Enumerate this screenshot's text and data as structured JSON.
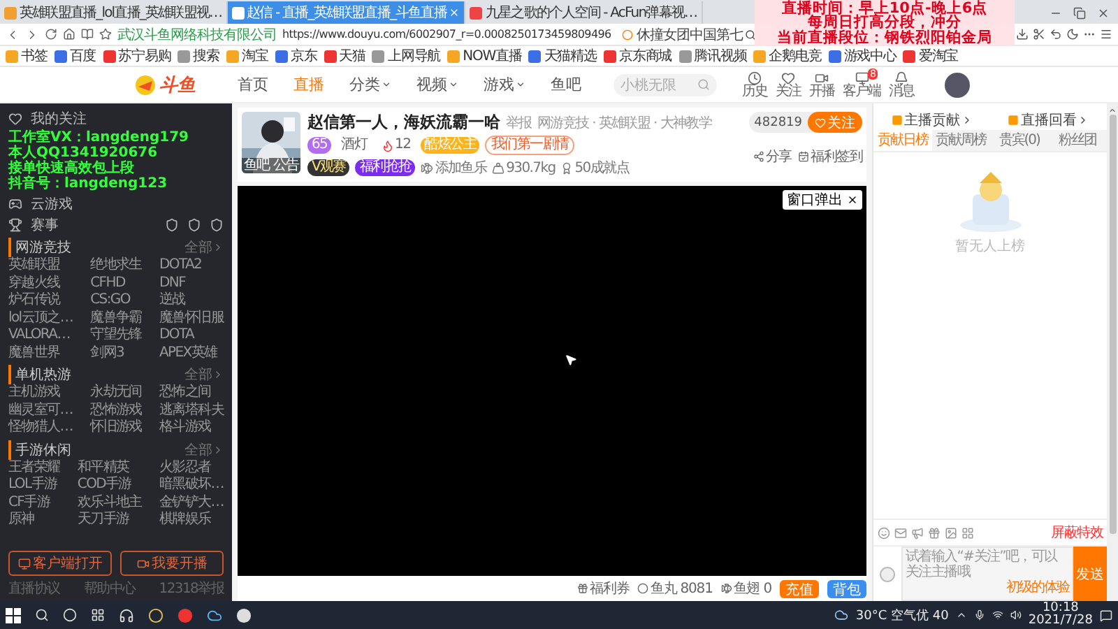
{
  "browser": {
    "tabs": [
      {
        "title": "英雄联盟直播_lol直播_英雄联盟视…",
        "selected": false
      },
      {
        "title": "赵信 - 直播_英雄联盟直播_斗鱼直播",
        "selected": true
      },
      {
        "title": "九星之歌的个人空间 - AcFun弹幕视…",
        "selected": false
      }
    ],
    "site_identity": "武汉斗鱼网络科技有限公司",
    "url": "https://www.douyu.com/6002907_r=0.0008250173459809496",
    "search": {
      "value": "休撞女团中国第七"
    },
    "bookmarks": [
      "书签",
      "百度",
      "苏宁易购",
      "搜索",
      "淘宝",
      "京东",
      "天猫",
      "上网导航",
      "NOW直播",
      "天猫精选",
      "京东商城",
      "腾讯视频",
      "企鹅电竞",
      "游戏中心",
      "爱淘宝"
    ]
  },
  "schedule_overlay": [
    "直播时间：早上10点-晚上6点",
    "每周日打高分段，冲分",
    "当前直播段位：钢铁烈阳铂金局"
  ],
  "site_nav": {
    "logo": "斗鱼",
    "items": [
      {
        "label": "首页",
        "selected": false,
        "has_menu": false
      },
      {
        "label": "直播",
        "selected": true,
        "has_menu": false
      },
      {
        "label": "分类",
        "selected": false,
        "has_menu": true
      },
      {
        "label": "视频",
        "selected": false,
        "has_menu": true
      },
      {
        "label": "游戏",
        "selected": false,
        "has_menu": true
      },
      {
        "label": "鱼吧",
        "selected": false,
        "has_menu": false
      }
    ],
    "search": {
      "placeholder": "小桃无限"
    },
    "user_icons": [
      {
        "kind": "history",
        "label": "历史"
      },
      {
        "kind": "follow",
        "label": "关注"
      },
      {
        "kind": "broadcast",
        "label": "开播"
      },
      {
        "kind": "client",
        "label": "客户端",
        "badge": "8"
      },
      {
        "kind": "message",
        "label": "消息"
      }
    ]
  },
  "sidebar": {
    "follow": "我的关注",
    "contact_overlay": [
      "工作室VX：langdeng179",
      "本人QQ1341920676",
      "接单快速高效包上段",
      "抖音号：langdeng123"
    ],
    "cloud": "云游戏",
    "events": "赛事",
    "sections": [
      {
        "title": "网游竞技",
        "more": "全部",
        "items": [
          "英雄联盟",
          "绝地求生",
          "DOTA2",
          "穿越火线",
          "CFHD",
          "DNF",
          "炉石传说",
          "CS:GO",
          "逆战",
          "lol云顶之…",
          "魔兽争霸",
          "魔兽怀旧服",
          "VALORA…",
          "守望先锋",
          "DOTA",
          "魔兽世界",
          "剑网3",
          "APEX英雄"
        ]
      },
      {
        "title": "单机热游",
        "more": "全部",
        "items": [
          "主机游戏",
          "永劫无间",
          "恐怖之间",
          "幽灵室可…",
          "恐怖游戏",
          "逃离塔科夫",
          "怪物猎人…",
          "怀旧游戏",
          "格斗游戏"
        ]
      },
      {
        "title": "手游休闲",
        "more": "全部",
        "items": [
          "王者荣耀",
          "和平精英",
          "火影忍者",
          "LOL手游",
          "COD手游",
          "暗黑破坏…",
          "CF手游",
          "欢乐斗地主",
          "金铲铲大…",
          "原神",
          "天刀手游",
          "棋牌娱乐"
        ]
      }
    ],
    "buttons": [
      "客户端打开",
      "我要开播"
    ],
    "footer": [
      "直播协议",
      "帮助中心",
      "12318举报"
    ]
  },
  "streamer": {
    "avatar_caption": [
      "鱼吧",
      "公告"
    ],
    "title": "赵信第一人，海妖流霸一哈",
    "report": "举报",
    "breadcrumbs": "网游竞技 · 英雄联盟 · 大神教学",
    "badges": [
      {
        "kind": "level",
        "text": "65"
      },
      {
        "kind": "plain",
        "text": "酒灯"
      },
      {
        "kind": "hot",
        "text": "12"
      },
      {
        "kind": "gold",
        "text": "酷炫公主"
      },
      {
        "kind": "outline",
        "text": "我们第一剧情"
      }
    ],
    "tags": [
      {
        "kind": "dark",
        "text": "V观赛"
      },
      {
        "kind": "purple",
        "text": "福利抢抢"
      }
    ],
    "stats": [
      {
        "kind": "fish",
        "text": "添加鱼乐"
      },
      {
        "kind": "weight",
        "text": "930.7kg"
      },
      {
        "kind": "trophy",
        "text": "50成就点"
      }
    ],
    "followers": "482819",
    "follow": "关注",
    "share": "分享",
    "sign_in": "福利签到"
  },
  "video": {
    "popout": "窗口弹出"
  },
  "bottom_bar": {
    "coupon": "福利券",
    "fish_balls": "鱼丸 8081",
    "fins": "鱼翅 0",
    "recharge": "充值",
    "backpack": "背包"
  },
  "right_panel": {
    "links": [
      "主播贡献",
      "直播回看"
    ],
    "tabs": [
      {
        "label": "贡献日榜",
        "selected": true
      },
      {
        "label": "贡献周榜",
        "selected": false
      },
      {
        "label": "贵宾(0)",
        "selected": false
      },
      {
        "label": "粉丝团",
        "selected": false
      }
    ],
    "empty": "暂无人上榜",
    "block_effects": "屏蔽特效",
    "chat": {
      "placeholder": "试着输入“#关注”吧，可以关注主播哦",
      "level_note": "初级的体验",
      "send": "发送"
    }
  },
  "taskbar": {
    "weather": "30°C 空气优 40",
    "time": "10:18",
    "date": "2021/7/28"
  }
}
